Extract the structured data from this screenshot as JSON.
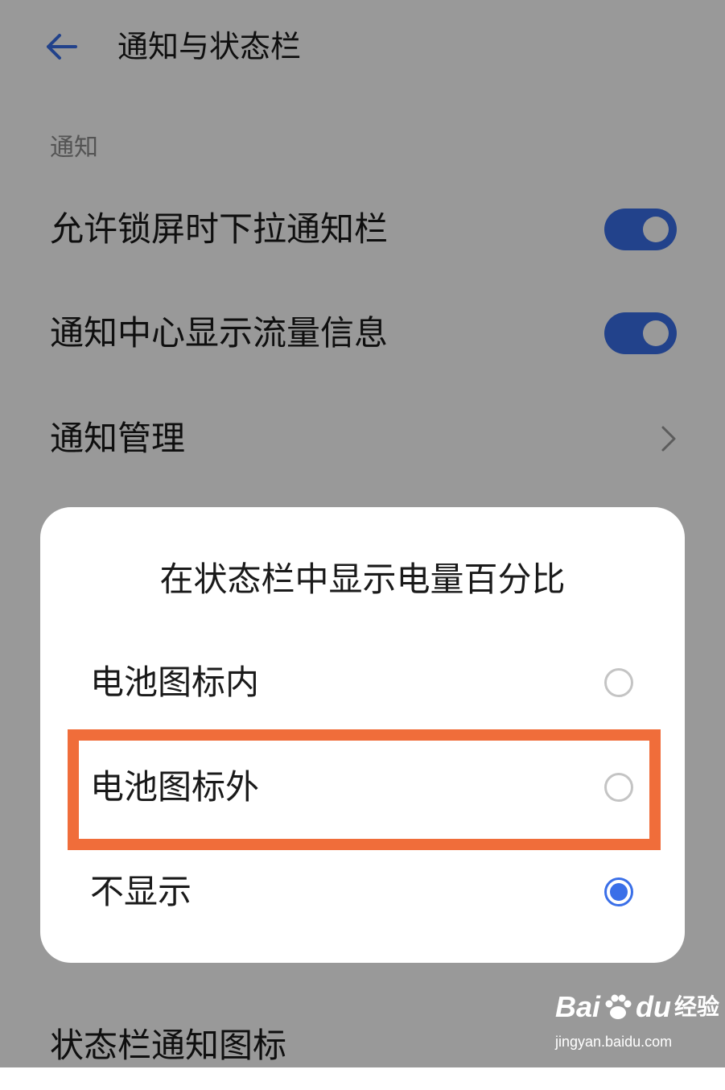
{
  "header": {
    "title": "通知与状态栏"
  },
  "section": {
    "notifications_label": "通知"
  },
  "settings": {
    "rows": [
      {
        "label": "允许锁屏时下拉通知栏",
        "control": "toggle",
        "on": true
      },
      {
        "label": "通知中心显示流量信息",
        "control": "toggle",
        "on": true
      },
      {
        "label": "通知管理",
        "control": "chevron"
      },
      {
        "label": "状态栏通知图标",
        "control": "none"
      }
    ]
  },
  "dialog": {
    "title": "在状态栏中显示电量百分比",
    "options": [
      {
        "label": "电池图标内",
        "selected": false
      },
      {
        "label": "电池图标外",
        "selected": false
      },
      {
        "label": "不显示",
        "selected": true
      }
    ],
    "highlighted_option": "电池图标外"
  },
  "watermark": {
    "brand_left": "Bai",
    "brand_right": "du",
    "brand_cn": "经验",
    "url": "jingyan.baidu.com"
  },
  "colors": {
    "accent": "#3a6fe8",
    "highlight": "#f06d3a",
    "text_primary": "#1a1a1a",
    "text_secondary": "#8c8c8c"
  }
}
